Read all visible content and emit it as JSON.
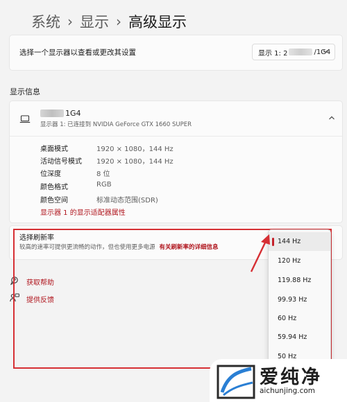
{
  "breadcrumb": {
    "items": [
      "系统",
      "显示",
      "高级显示"
    ],
    "separator": "›"
  },
  "monitor_select": {
    "label": "选择一个显示器以查看或更改其设置",
    "selected_prefix": "显示 1: 2",
    "selected_suffix": "/1G4"
  },
  "display_info": {
    "section_title": "显示信息",
    "name_suffix": "1G4",
    "subtitle": "显示器 1: 已连接到 NVIDIA GeForce GTX 1660 SUPER",
    "properties": [
      {
        "key": "桌面模式",
        "value": "1920 × 1080，144 Hz"
      },
      {
        "key": "活动信号模式",
        "value": "1920 × 1080，144 Hz"
      },
      {
        "key": "位深度",
        "value": "8 位"
      },
      {
        "key": "颜色格式",
        "value": "RGB"
      },
      {
        "key": "颜色空间",
        "value": "标准动态范围(SDR)"
      }
    ],
    "adapter_link": "显示器 1 的显示适配器属性"
  },
  "refresh_rate": {
    "title": "选择刷新率",
    "description": "较高的速率可提供更流畅的动作，但也使用更多电源",
    "link": "有关刷新率的详细信息",
    "options": [
      "144 Hz",
      "120 Hz",
      "119.88 Hz",
      "99.93 Hz",
      "60 Hz",
      "59.94 Hz",
      "50 Hz"
    ],
    "selected_index": 0
  },
  "help_links": {
    "get_help": "获取帮助",
    "feedback": "提供反馈"
  },
  "watermark": {
    "title": "爱纯净",
    "url": "aichunjing.com"
  },
  "colors": {
    "accent_red": "#c4202a",
    "link_red": "#b0161e",
    "annotation_red": "#d62f34"
  }
}
